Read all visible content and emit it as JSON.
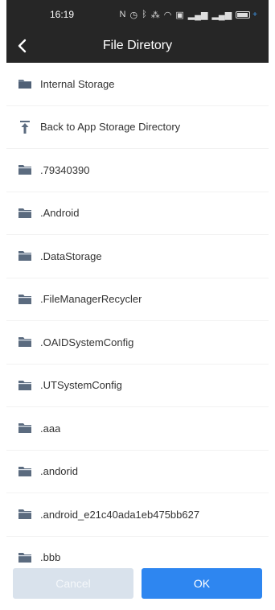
{
  "status": {
    "time": "16:19",
    "icons": [
      "nfc-icon",
      "alarm-icon",
      "bluetooth-icon",
      "vibrate-icon",
      "wifi-icon",
      "hd-icon",
      "signal-icon",
      "signal-icon",
      "battery-icon"
    ]
  },
  "header": {
    "title": "File Diretory",
    "back_icon": "chevron-left-icon"
  },
  "list": {
    "items": [
      {
        "label": "Internal Storage",
        "icon": "folder-open-icon"
      },
      {
        "label": "Back to App Storage Directory",
        "icon": "upload-icon"
      },
      {
        "label": ".79340390",
        "icon": "folder-icon"
      },
      {
        "label": ".Android",
        "icon": "folder-icon"
      },
      {
        "label": ".DataStorage",
        "icon": "folder-icon"
      },
      {
        "label": ".FileManagerRecycler",
        "icon": "folder-icon"
      },
      {
        "label": ".OAIDSystemConfig",
        "icon": "folder-icon"
      },
      {
        "label": ".UTSystemConfig",
        "icon": "folder-icon"
      },
      {
        "label": ".aaa",
        "icon": "folder-icon"
      },
      {
        "label": ".andorid",
        "icon": "folder-icon"
      },
      {
        "label": ".android_e21c40ada1eb475bb627",
        "icon": "folder-icon"
      },
      {
        "label": ".bbb",
        "icon": "folder-icon"
      }
    ]
  },
  "footer": {
    "cancel_label": "Cancel",
    "ok_label": "OK"
  },
  "colors": {
    "header_bg": "#262626",
    "folder_icon": "#5b6b7f",
    "ok_button": "#2e86f0",
    "cancel_button": "#d9e2ec"
  }
}
